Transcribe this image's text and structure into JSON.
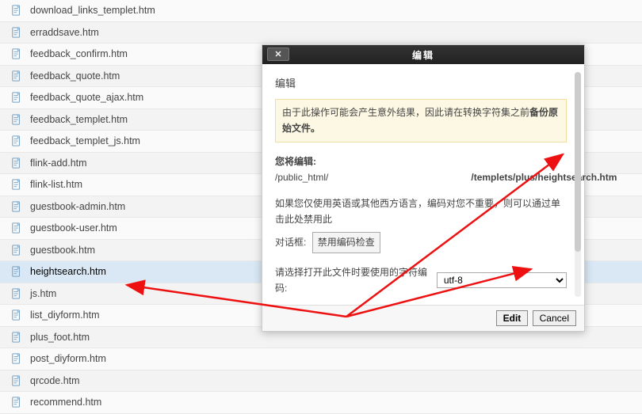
{
  "files": [
    "download_links_templet.htm",
    "erraddsave.htm",
    "feedback_confirm.htm",
    "feedback_quote.htm",
    "feedback_quote_ajax.htm",
    "feedback_templet.htm",
    "feedback_templet_js.htm",
    "flink-add.htm",
    "flink-list.htm",
    "guestbook-admin.htm",
    "guestbook-user.htm",
    "guestbook.htm",
    "heightsearch.htm",
    "js.htm",
    "list_diyform.htm",
    "plus_foot.htm",
    "post_diyform.htm",
    "qrcode.htm",
    "recommend.htm"
  ],
  "selected_index": 12,
  "modal": {
    "title": "编辑",
    "close_glyph": "✕",
    "heading": "编辑",
    "warning_prefix": "由于此操作可能会产生意外结果，因此请在转换字符集之前",
    "warning_strong": "备份原始文件。",
    "path_label": "您将编辑:",
    "path_prefix": "/public_html/",
    "path_suffix": "/templets/plus/heightsearch.htm",
    "encoding_note": "如果您仅使用英语或其他西方语言，编码对您不重要，则可以通过单击此处禁用此",
    "dialog_label": "对话框:",
    "disable_btn": "禁用编码检查",
    "charset_label": "请选择打开此文件时要使用的字符编码:",
    "charset_value": "utf-8",
    "edit_btn": "Edit",
    "cancel_btn": "Cancel"
  }
}
